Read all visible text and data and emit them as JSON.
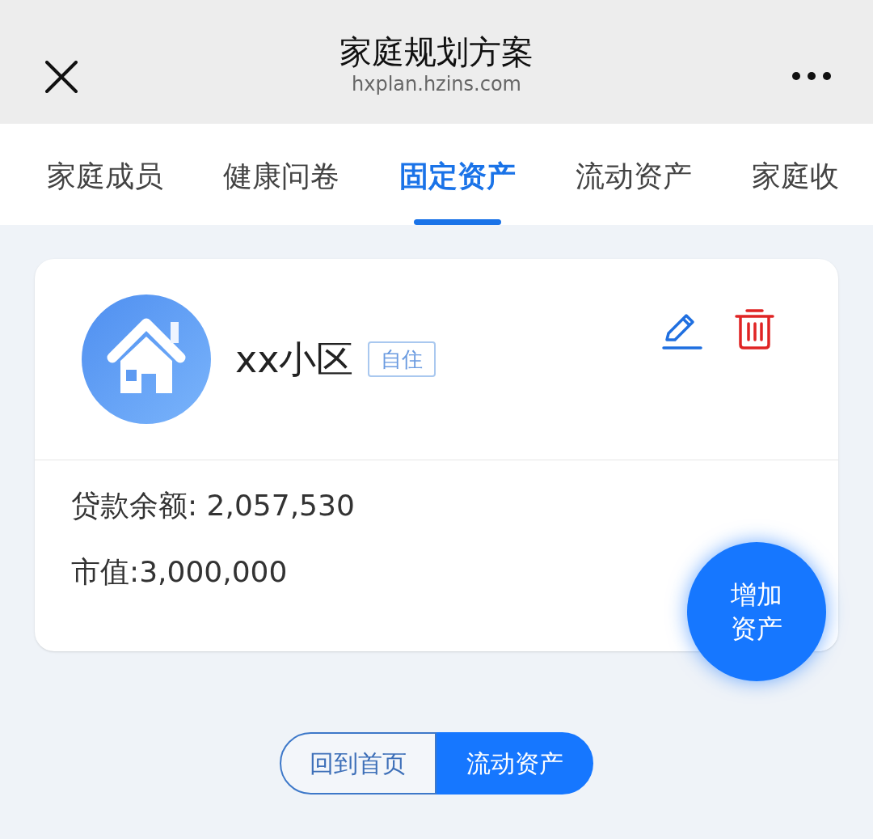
{
  "header": {
    "title": "家庭规划方案",
    "subtitle": "hxplan.hzins.com"
  },
  "tabs": [
    {
      "label": "家庭成员",
      "selected": false
    },
    {
      "label": "健康问卷",
      "selected": false
    },
    {
      "label": "固定资产",
      "selected": true
    },
    {
      "label": "流动资产",
      "selected": false
    },
    {
      "label": "家庭收",
      "selected": false
    }
  ],
  "asset_card": {
    "name": "xx小区",
    "tag": "自住",
    "lines": [
      "贷款余额: 2,057,530",
      "市值:3,000,000"
    ]
  },
  "fab": {
    "label": "增加资产"
  },
  "bottom_buttons": [
    {
      "label": "回到首页",
      "selected": false
    },
    {
      "label": "流动资产",
      "selected": true
    }
  ]
}
